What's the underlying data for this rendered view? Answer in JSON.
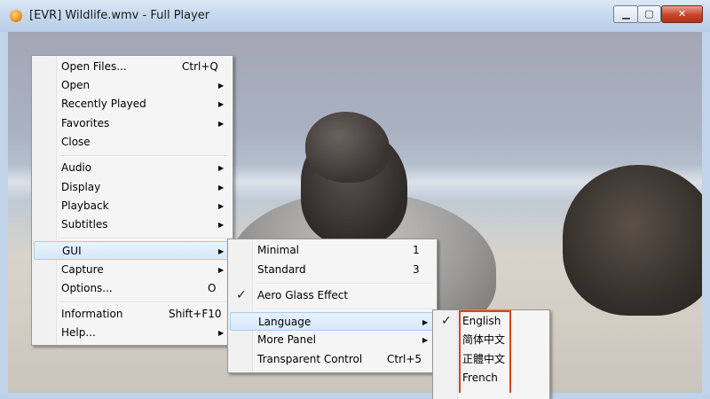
{
  "window": {
    "title": "[EVR] Wildlife.wmv - Full Player",
    "minimize_glyph": "▁",
    "maximize_glyph": "▢",
    "close_glyph": "✕"
  },
  "main_menu": {
    "items": [
      {
        "label": "Open Files...",
        "shortcut": "Ctrl+Q"
      },
      {
        "label": "Open",
        "arrow": "▶"
      },
      {
        "label": "Recently Played",
        "arrow": "▶"
      },
      {
        "label": "Favorites",
        "arrow": "▶"
      },
      {
        "label": "Close"
      },
      {
        "label": "Audio",
        "arrow": "▶"
      },
      {
        "label": "Display",
        "arrow": "▶"
      },
      {
        "label": "Playback",
        "arrow": "▶"
      },
      {
        "label": "Subtitles",
        "arrow": "▶"
      },
      {
        "label": "GUI",
        "arrow": "▶"
      },
      {
        "label": "Capture",
        "arrow": "▶"
      },
      {
        "label": "Options...",
        "shortcut": "O"
      },
      {
        "label": "Information",
        "shortcut": "Shift+F10"
      },
      {
        "label": "Help...",
        "arrow": "▶"
      }
    ]
  },
  "gui_menu": {
    "items": [
      {
        "label": "Minimal",
        "shortcut": "1"
      },
      {
        "label": "Standard",
        "shortcut": "3"
      },
      {
        "label": "Aero Glass Effect",
        "check": "✓"
      },
      {
        "label": "Language",
        "arrow": "▶"
      },
      {
        "label": "More Panel",
        "arrow": "▶"
      },
      {
        "label": "Transparent Control",
        "shortcut": "Ctrl+5"
      }
    ]
  },
  "language_menu": {
    "items": [
      {
        "label": "English",
        "check": "✓"
      },
      {
        "label": "简体中文"
      },
      {
        "label": "正體中文"
      },
      {
        "label": "French"
      }
    ]
  },
  "colors": {
    "highlight_border": "#d9431c",
    "menu_hover": "#d6e8fc"
  }
}
